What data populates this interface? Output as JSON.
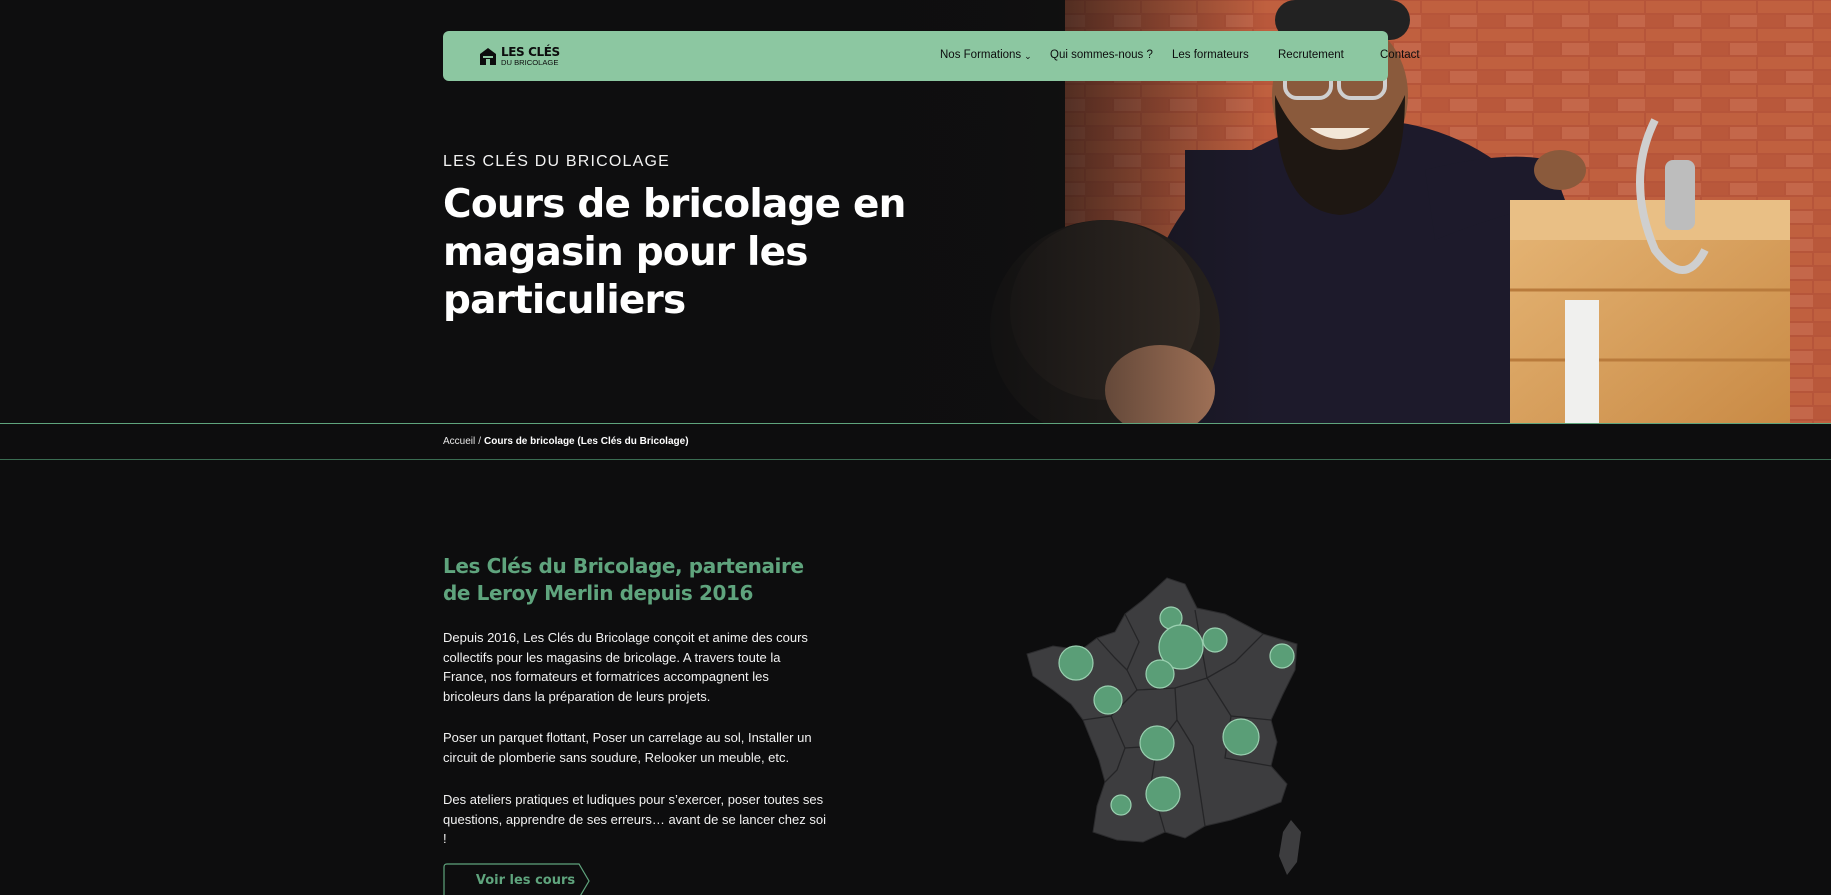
{
  "brand": {
    "logo_line1": "LES CLÉS",
    "logo_line2": "DU BRICOLAGE"
  },
  "nav": {
    "items": [
      {
        "label": "Nos Formations",
        "has_dropdown": true
      },
      {
        "label": "Qui sommes-nous ?"
      },
      {
        "label": "Les formateurs"
      },
      {
        "label": "Recrutement"
      },
      {
        "label": "Contact"
      }
    ]
  },
  "hero": {
    "kicker": "LES CLÉS DU BRICOLAGE",
    "title": "Cours de bricolage en magasin pour les particuliers"
  },
  "breadcrumb": {
    "home": "Accueil",
    "separator": "/",
    "current": "Cours de bricolage (Les Clés du Bricolage)"
  },
  "intro": {
    "title": "Les Clés du Bricolage, partenaire de Leroy Merlin depuis 2016",
    "paragraph1": "Depuis 2016, Les Clés du Bricolage conçoit et anime des cours collectifs pour les magasins de bricolage. A travers toute la France, nos formateurs et formatrices accompagnent les bricoleurs dans la préparation de leurs projets.",
    "paragraph2": "Poser un parquet flottant, Poser un carrelage au sol, Installer un circuit de plomberie sans soudure, Relooker un meuble, etc.",
    "paragraph3": "Des ateliers pratiques et ludiques pour s’exercer, poser toutes ses questions, apprendre de ses erreurs… avant de se lancer chez soi !",
    "cta_label": "Voir les cours"
  },
  "colors": {
    "accent_green": "#5fa47d",
    "nav_green": "#8cc7a1",
    "background": "#0d0d0e",
    "map_fill": "#3d3d3f"
  },
  "icons": {
    "logo": "house-key-logo-icon",
    "dropdown": "chevron-down-icon",
    "map": "france-map-icon"
  }
}
